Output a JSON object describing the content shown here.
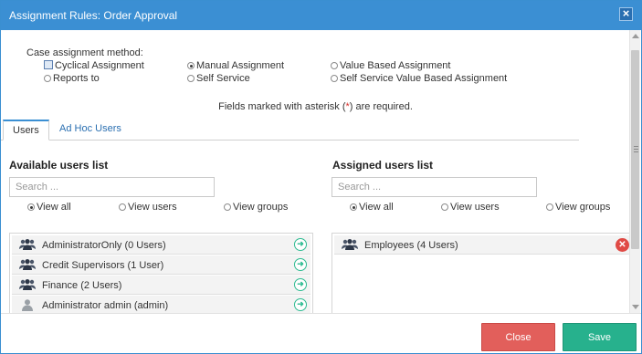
{
  "window": {
    "title": "Assignment Rules: Order Approval",
    "close_glyph": "×"
  },
  "method": {
    "label": "Case assignment method:",
    "options": [
      {
        "label": "Cyclical Assignment",
        "control": "checkbox",
        "selected": false
      },
      {
        "label": "Manual Assignment",
        "control": "radio",
        "selected": true
      },
      {
        "label": "Value Based Assignment",
        "control": "radio",
        "selected": false
      },
      {
        "label": "Reports to",
        "control": "radio",
        "selected": false
      },
      {
        "label": "Self Service",
        "control": "radio",
        "selected": false
      },
      {
        "label": "Self Service Value Based Assignment",
        "control": "radio",
        "selected": false
      }
    ]
  },
  "required_note": {
    "before": "Fields marked with asterisk (",
    "asterisk": "*",
    "after": ") are required."
  },
  "tabs": [
    {
      "label": "Users",
      "active": true
    },
    {
      "label": "Ad Hoc Users",
      "active": false
    }
  ],
  "available": {
    "heading": "Available users list",
    "search_placeholder": "Search ...",
    "filters": [
      {
        "label": "View all",
        "selected": true
      },
      {
        "label": "View users",
        "selected": false
      },
      {
        "label": "View groups",
        "selected": false
      }
    ],
    "items": [
      {
        "label": "AdministratorOnly (0 Users)",
        "icon": "group-icon"
      },
      {
        "label": "Credit Supervisors (1 User)",
        "icon": "group-icon"
      },
      {
        "label": "Finance (2 Users)",
        "icon": "group-icon"
      },
      {
        "label": "Administrator admin (admin)",
        "icon": "user-icon"
      }
    ]
  },
  "assigned": {
    "heading": "Assigned users list",
    "search_placeholder": "Search ...",
    "filters": [
      {
        "label": "View all",
        "selected": true
      },
      {
        "label": "View users",
        "selected": false
      },
      {
        "label": "View groups",
        "selected": false
      }
    ],
    "items": [
      {
        "label": "Employees (4 Users)",
        "icon": "group-icon"
      }
    ]
  },
  "footer": {
    "close_label": "Close",
    "save_label": "Save"
  },
  "colors": {
    "titlebar": "#3b8fd3",
    "close": "#e25f5b",
    "save": "#27b18d",
    "add": "#2dbb91",
    "remove": "#e04a45",
    "asterisk": "#d9332e"
  }
}
